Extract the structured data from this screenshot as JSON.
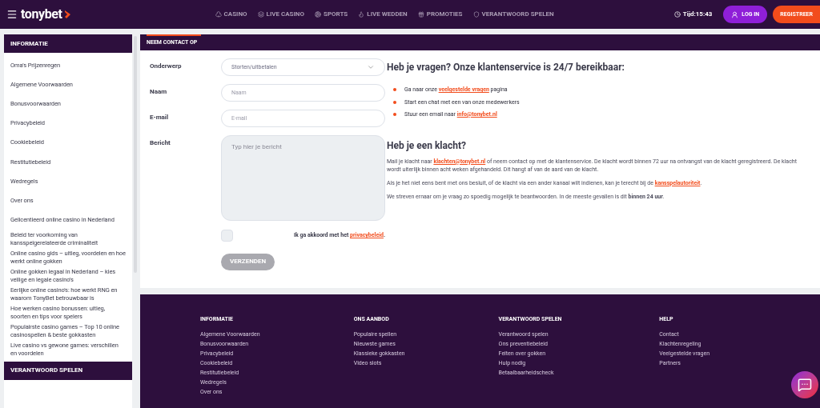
{
  "header": {
    "logo": "tonybet",
    "nav": [
      {
        "label": "CASINO"
      },
      {
        "label": "LIVE CASINO"
      },
      {
        "label": "SPORTS"
      },
      {
        "label": "LIVE WEDDEN"
      },
      {
        "label": "PROMOTIES"
      },
      {
        "label": "VERANTWOORD SPELEN"
      }
    ],
    "time": "Tijd:15:43",
    "login": "LOG IN",
    "register": "REGISTREER"
  },
  "sidebar": {
    "sections": [
      {
        "title": "INFORMATIE",
        "items": [
          "Oma's Prijzenregen",
          "Algemene Voorwaarden",
          "Bonusvoorwaarden",
          "Privacybeleid",
          "Cookiebeleid",
          "Restitutiebeleid",
          "Wedregels",
          "Over ons",
          "Gelicentieerd online casino in Nederland",
          "Beleid ter voorkoming van kansspelgerelateerde criminaliteit",
          "Online casino gids – uitleg, voordelen en hoe werkt online gokken",
          "Online gokken legaal in Nederland – kies veilige en legale casino's",
          "Eerlijke online casino's: hoe werkt RNG en waarom TonyBet betrouwbaar is",
          "Hoe werken casino bonussen: uitleg, soorten en tips voor spelers",
          "Populairste casino games – Top 10 online casinospellen & beste gokkasten",
          "Live casino vs gewone games: verschillen en voordelen"
        ]
      },
      {
        "title": "VERANTWOORD SPELEN"
      }
    ]
  },
  "contact": {
    "title": "NEEM CONTACT OP",
    "fields": [
      {
        "kind": "select",
        "label": "Onderwerp",
        "value": "Storten/uitbetalen"
      },
      {
        "kind": "input",
        "label": "Naam",
        "placeholder": "Naam"
      },
      {
        "kind": "input",
        "label": "E-mail",
        "placeholder": "E-mail"
      },
      {
        "kind": "textarea",
        "label": "Bericht",
        "placeholder": "Typ hier je bericht"
      }
    ],
    "consent": {
      "checked": false,
      "parts": [
        {
          "kind": "text",
          "text": "Ik ga akkoord met het "
        },
        {
          "kind": "link",
          "text": "privacybeleid"
        },
        {
          "kind": "text",
          "text": "."
        }
      ]
    },
    "submit": {
      "label": "VERZENDEN",
      "disabled": true
    },
    "questions": {
      "heading": "Heb je vragen? Onze klantenservice is 24/7 bereikbaar:",
      "bullets": [
        [
          {
            "kind": "text",
            "text": "Ga naar onze "
          },
          {
            "kind": "link",
            "text": "veelgestelde vragen"
          },
          {
            "kind": "text",
            "text": " pagina"
          }
        ],
        [
          {
            "kind": "text",
            "text": "Start een chat met een van onze medewerkers"
          }
        ],
        [
          {
            "kind": "text",
            "text": "Stuur een email naar "
          },
          {
            "kind": "link",
            "text": "info@tonybet.nl"
          }
        ]
      ]
    },
    "complaint": {
      "heading": "Heb je een klacht?",
      "paragraphs": [
        [
          {
            "kind": "text",
            "text": "Mail je klacht naar "
          },
          {
            "kind": "link",
            "text": "klachten@tonybet.nl"
          },
          {
            "kind": "text",
            "text": " of neem contact op met de klantenservice. De klacht wordt binnen 72 uur na ontvangst van de klacht geregistreerd. De klacht wordt uiterlijk binnen acht weken afgehandeld. Dit hangt af van de aard van de klacht."
          }
        ],
        [
          {
            "kind": "text",
            "text": "Als je het niet eens bent met ons besluit, of de klacht via een ander kanaal wilt indienen, kan je terecht bij de "
          },
          {
            "kind": "link",
            "text": "kansspelautoriteit"
          },
          {
            "kind": "text",
            "text": "."
          }
        ],
        [
          {
            "kind": "text",
            "text": "We streven ernaar om je vraag zo spoedig mogelijk te beantwoorden. In de meeste gevallen is dit "
          },
          {
            "kind": "bold",
            "text": "binnen 24 uur"
          },
          {
            "kind": "text",
            "text": "."
          }
        ]
      ]
    }
  },
  "footer": {
    "columns": [
      {
        "title": "INFORMATIE",
        "links": [
          "Algemene Voorwaarden",
          "Bonusvoorwaarden",
          "Privacybeleid",
          "Cookiebeleid",
          "Restitutiebeleid",
          "Wedregels",
          "Over ons"
        ]
      },
      {
        "title": "ONS AANBOD",
        "links": [
          "Populaire spellen",
          "Nieuwste games",
          "Klassieke gokkasten",
          "Video slots"
        ]
      },
      {
        "title": "VERANTWOORD SPELEN",
        "links": [
          "Verantwoord spelen",
          "Ons preventiebeleid",
          "Feiten over gokken",
          "Hulp nodig",
          "Betaalbaarheidscheck"
        ]
      },
      {
        "title": "HELP",
        "links": [
          "Contact",
          "Klachtenregeling",
          "Veelgestelde vragen",
          "Partners"
        ]
      }
    ]
  }
}
